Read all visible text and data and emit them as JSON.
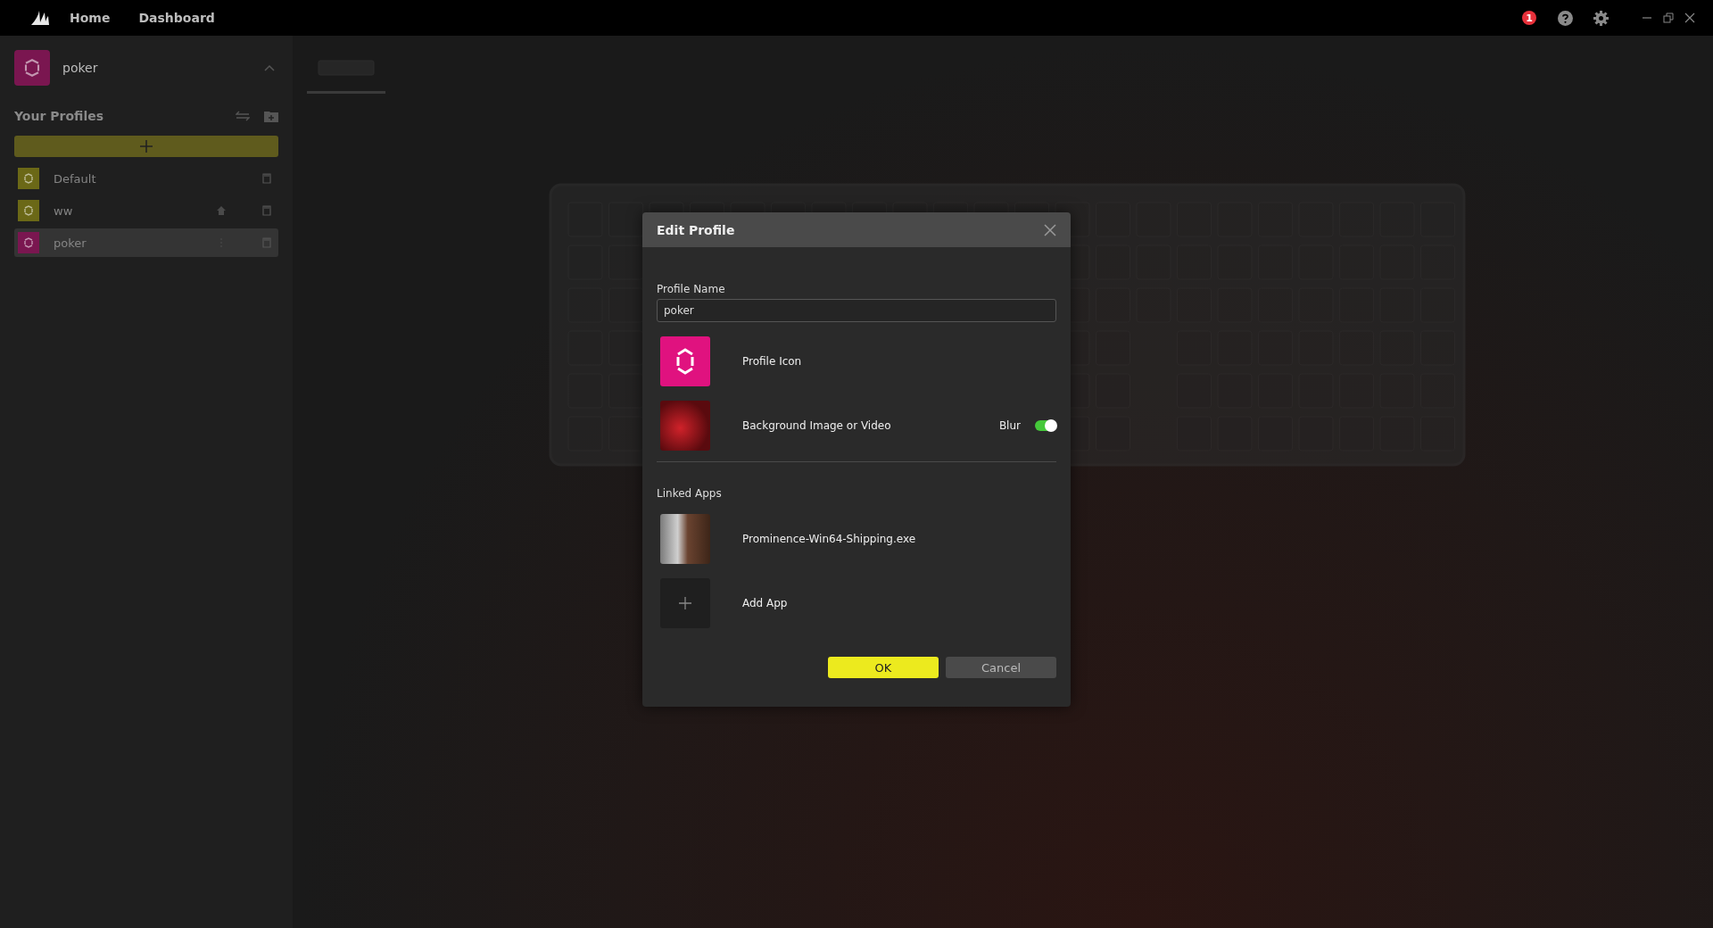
{
  "top_bar": {
    "nav": [
      {
        "label": "Home"
      },
      {
        "label": "Dashboard"
      }
    ],
    "notification_count": "1"
  },
  "sidebar": {
    "current_profile": {
      "name": "poker",
      "color": "#7a1650"
    },
    "section_title": "Your Profiles",
    "profiles": [
      {
        "name": "Default",
        "color": "#6b6817",
        "home": false,
        "selected": false
      },
      {
        "name": "ww",
        "color": "#6b6817",
        "home": true,
        "selected": false
      },
      {
        "name": "poker",
        "color": "#7a1650",
        "home": false,
        "selected": true
      }
    ]
  },
  "dialog": {
    "title": "Edit Profile",
    "name_label": "Profile Name",
    "name_value": "poker",
    "profile_icon_label": "Profile Icon",
    "background_label": "Background Image or Video",
    "blur_label": "Blur",
    "blur_on": true,
    "linked_apps_title": "Linked Apps",
    "apps": [
      {
        "name": "Prominence-Win64-Shipping.exe"
      }
    ],
    "add_app_label": "Add App",
    "buttons": [
      {
        "label": "OK",
        "kind": "primary"
      },
      {
        "label": "Cancel",
        "kind": "secondary"
      }
    ]
  }
}
